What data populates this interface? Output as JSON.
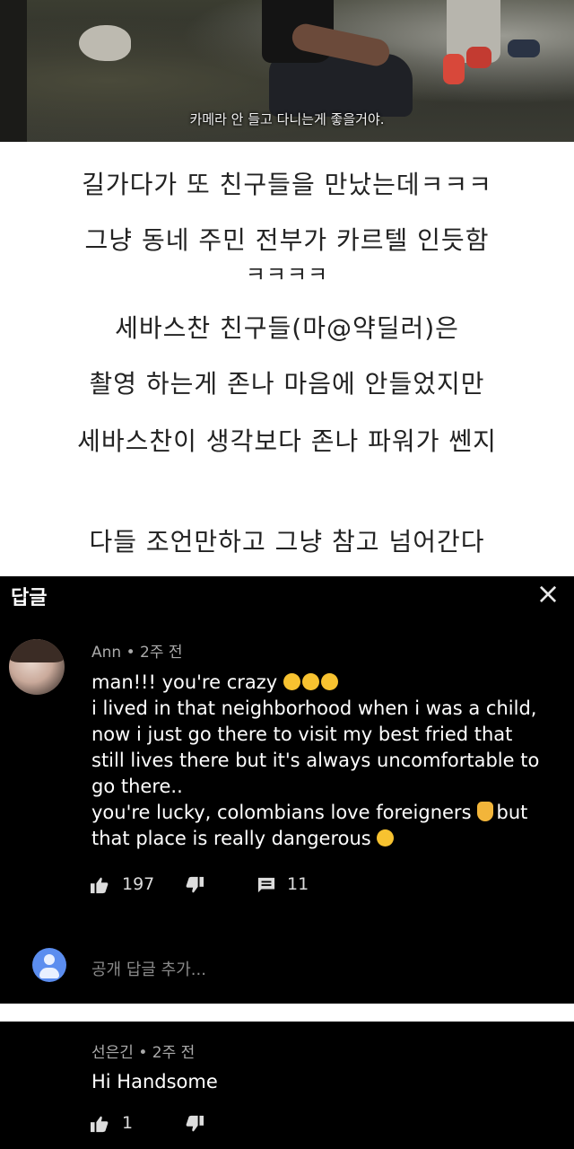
{
  "video": {
    "subtitle": "카메라 안 들고 다니는게 좋을거야."
  },
  "caption": {
    "lines": [
      "길가다가 또 친구들을 만났는데ㅋㅋㅋ",
      "그냥 동네 주민 전부가 카르텔 인듯함",
      "ㅋㅋㅋㅋ",
      "세바스찬 친구들(마@약딜러)은",
      "촬영 하는게 존나 마음에 안들었지만",
      "세바스찬이 생각보다 존나 파워가 쎈지",
      "다들 조언만하고 그냥 참고 넘어간다"
    ]
  },
  "reply_panel": {
    "title": "답글",
    "close_icon": "×",
    "comment": {
      "author": "Ann",
      "time": "2주 전",
      "meta": "Ann • 2주 전",
      "lines": [
        "man!!! you're crazy",
        "i lived in that neighborhood when i was a child,",
        "now i just go there to visit my best fried that",
        "still lives there but it's always uncomfortable to",
        "go there..",
        "you're lucky, colombians love foreigners",
        "but",
        "that place is really dangerous"
      ],
      "likes": "197",
      "replies": "11"
    },
    "add_reply_placeholder": "공개 답글 추가..."
  },
  "second_comment": {
    "meta": "선은긴 • 2주 전",
    "text": "Hi Handsome",
    "likes": "1"
  },
  "colors": {
    "panel_bg": "#000000",
    "meta_text": "#aaaaaa",
    "accent_avatar": "#5b8def"
  },
  "icons": [
    "thumbs-up-icon",
    "thumbs-down-icon",
    "reply-icon",
    "close-icon",
    "user-avatar-icon"
  ]
}
